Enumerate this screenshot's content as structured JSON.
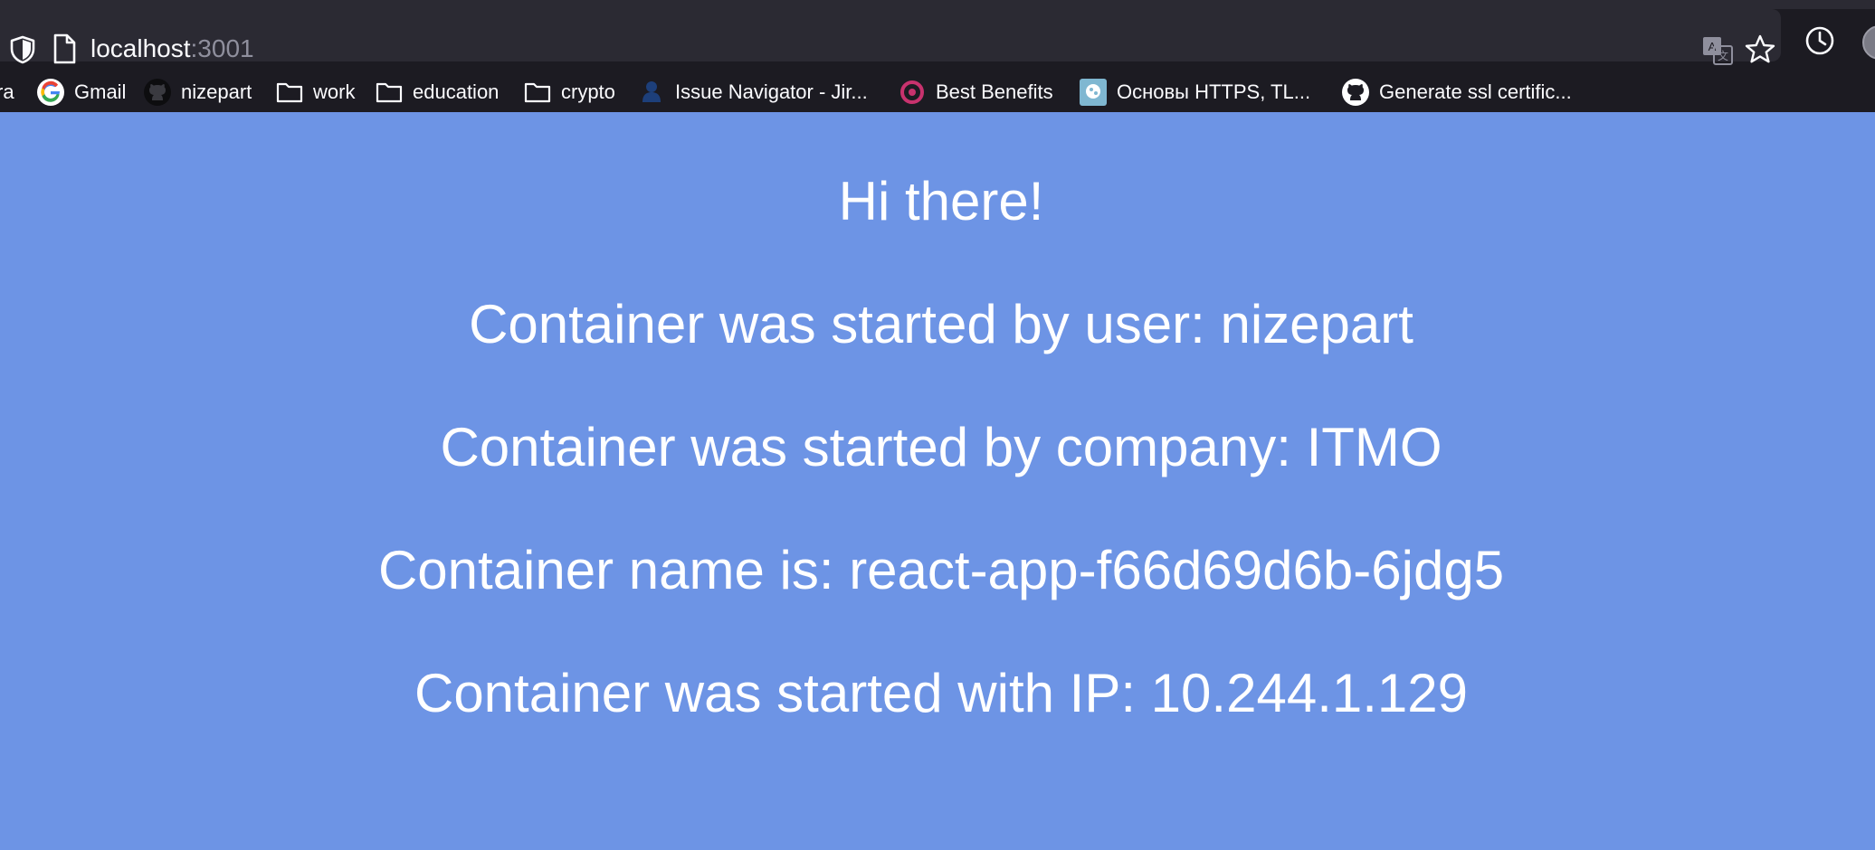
{
  "browser": {
    "url_host": "localhost",
    "url_port": ":3001"
  },
  "bookmarks": [
    {
      "label": "ra",
      "icon": "partial-bookmark"
    },
    {
      "label": "Gmail",
      "icon": "google-icon"
    },
    {
      "label": "nizepart",
      "icon": "github-icon"
    },
    {
      "label": "work",
      "icon": "folder-icon"
    },
    {
      "label": "education",
      "icon": "folder-icon"
    },
    {
      "label": "crypto",
      "icon": "folder-icon"
    },
    {
      "label": "Issue Navigator - Jir...",
      "icon": "jira-icon"
    },
    {
      "label": "Best Benefits",
      "icon": "benefits-icon"
    },
    {
      "label": "Основы HTTPS, TL...",
      "icon": "site-icon"
    },
    {
      "label": "Generate ssl certific...",
      "icon": "github-icon"
    }
  ],
  "page": {
    "greeting": "Hi there!",
    "user_line": "Container was started by user: nizepart",
    "company_line": "Container was started by company: ITMO",
    "name_line": "Container name is: react-app-f66d69d6b-6jdg5",
    "ip_line": "Container was started with IP: 10.244.1.129"
  },
  "colors": {
    "page_background": "#6d94e5",
    "chrome_background": "#1c1b22",
    "text": "#ffffff"
  }
}
